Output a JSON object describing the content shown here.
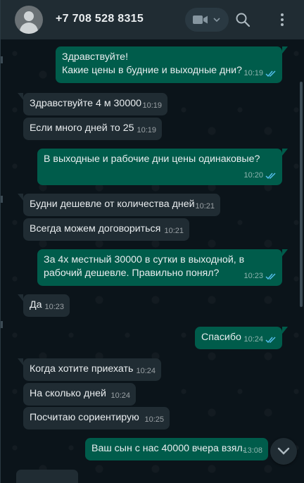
{
  "header": {
    "contact": "+7 708 528 8315",
    "icons": [
      "avatar",
      "video-call-icon",
      "chevron-down-icon",
      "search-icon",
      "menu-icon"
    ]
  },
  "messages": [
    {
      "dir": "out",
      "lines": "Здравствуйте!\nКакие цены в будние и выходные дни?",
      "time": "10:19",
      "read": true
    },
    {
      "dir": "in",
      "lines": "Здравствуйте 4 м 30000",
      "time": "10:19"
    },
    {
      "dir": "in",
      "lines": "Если много дней то 25",
      "time": "10:19"
    },
    {
      "dir": "out",
      "lines": "В выходные и рабочие дни цены одинаковые?",
      "time": "10:20",
      "read": true
    },
    {
      "dir": "in",
      "lines": "Будни дешевле от количества дней",
      "time": "10:21"
    },
    {
      "dir": "in",
      "lines": "Всегда можем договориться",
      "time": "10:21"
    },
    {
      "dir": "out",
      "lines": "За 4х местный 30000 в сутки в выходной, в\nрабочий дешевле. Правильно понял?",
      "time": "10:23",
      "read": true
    },
    {
      "dir": "in",
      "lines": "Да",
      "time": "10:23"
    },
    {
      "dir": "out",
      "lines": "Спасибо",
      "time": "10:24",
      "read": true
    },
    {
      "dir": "in",
      "lines": "Когда хотите приехать",
      "time": "10:24"
    },
    {
      "dir": "in",
      "lines": "На сколько дней",
      "time": "10:24"
    },
    {
      "dir": "in",
      "lines": "Посчитаю сориентирую",
      "time": "10:25"
    },
    {
      "dir": "out",
      "lines": "Ваш сын с нас 40000 вчера взял.",
      "time": "13:08",
      "read": false
    }
  ],
  "colors": {
    "background": "#0b141a",
    "header": "#202c33",
    "incoming": "#202c33",
    "outgoing": "#005c4b",
    "text": "#e9edef",
    "read_ticks": "#53bdeb"
  }
}
